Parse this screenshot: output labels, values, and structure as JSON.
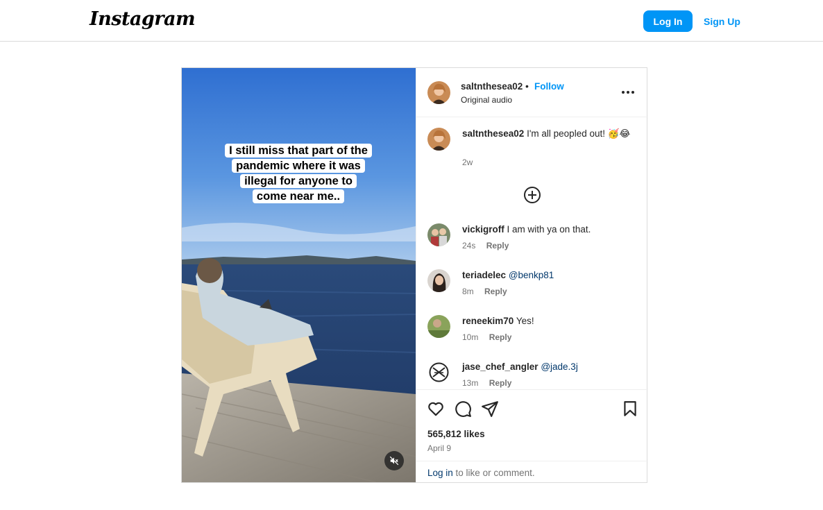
{
  "header": {
    "logo_text": "Instagram",
    "login_label": "Log In",
    "signup_label": "Sign Up"
  },
  "colors": {
    "accent": "#0095f6",
    "mention": "#00376b",
    "muted": "#737373"
  },
  "media": {
    "caption_lines": [
      "I still miss that part of the",
      "pandemic where it was",
      "illegal for anyone to",
      "come near me.."
    ],
    "mute_icon": "speaker-muted-icon"
  },
  "post": {
    "username": "saltnthesea02",
    "separator": "•",
    "follow_label": "Follow",
    "audio_label": "Original audio",
    "more_icon": "more-options-icon"
  },
  "caption": {
    "username": "saltnthesea02",
    "text": "I'm all peopled out! 🥳😂",
    "age": "2w"
  },
  "comments": [
    {
      "username": "vickigroff",
      "text": "I am with ya on that.",
      "mention": "",
      "age": "24s",
      "reply_label": "Reply"
    },
    {
      "username": "teriadelec",
      "text": "",
      "mention": "@benkp81",
      "age": "8m",
      "reply_label": "Reply"
    },
    {
      "username": "reneekim70",
      "text": "Yes!",
      "mention": "",
      "age": "10m",
      "reply_label": "Reply"
    },
    {
      "username": "jase_chef_angler",
      "text": "",
      "mention": "@jade.3j",
      "age": "13m",
      "reply_label": "Reply"
    }
  ],
  "actions": {
    "icons": [
      "heart-icon",
      "comment-icon",
      "share-icon",
      "bookmark-icon"
    ],
    "likes": "565,812 likes",
    "date": "April 9",
    "login_link": "Log in",
    "login_suffix": " to like or comment."
  }
}
